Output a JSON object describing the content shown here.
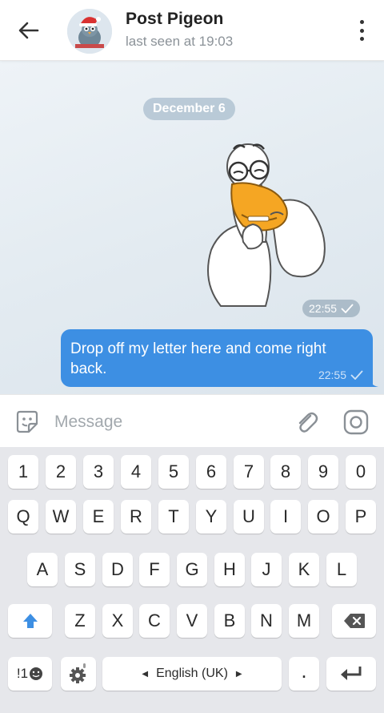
{
  "header": {
    "title": "Post Pigeon",
    "status": "last seen at 19:03",
    "back_icon": "arrow-left-icon",
    "menu_icon": "more-vertical-icon"
  },
  "chat": {
    "date_label": "December 6",
    "sticker": {
      "description_icon": "duck-sticker",
      "time": "22:55"
    },
    "message": {
      "text": "Drop off my letter here and come right back.",
      "time": "22:55"
    }
  },
  "input": {
    "placeholder": "Message",
    "emoji_icon": "sticker-emoji-icon",
    "attach_icon": "paperclip-icon",
    "camera_icon": "camera-icon"
  },
  "keyboard": {
    "number_row": [
      "1",
      "2",
      "3",
      "4",
      "5",
      "6",
      "7",
      "8",
      "9",
      "0"
    ],
    "row1": [
      "Q",
      "W",
      "E",
      "R",
      "T",
      "Y",
      "U",
      "I",
      "O",
      "P"
    ],
    "row2": [
      "A",
      "S",
      "D",
      "F",
      "G",
      "H",
      "J",
      "K",
      "L"
    ],
    "row3": [
      "Z",
      "X",
      "C",
      "V",
      "B",
      "N",
      "M"
    ],
    "symbols_label": "!1",
    "space_label": "English (UK)",
    "period_label": "."
  },
  "colors": {
    "accent": "#3d8fe3",
    "chat_bg": "#e3ebf1",
    "keyboard_bg": "#e6e7eb"
  }
}
